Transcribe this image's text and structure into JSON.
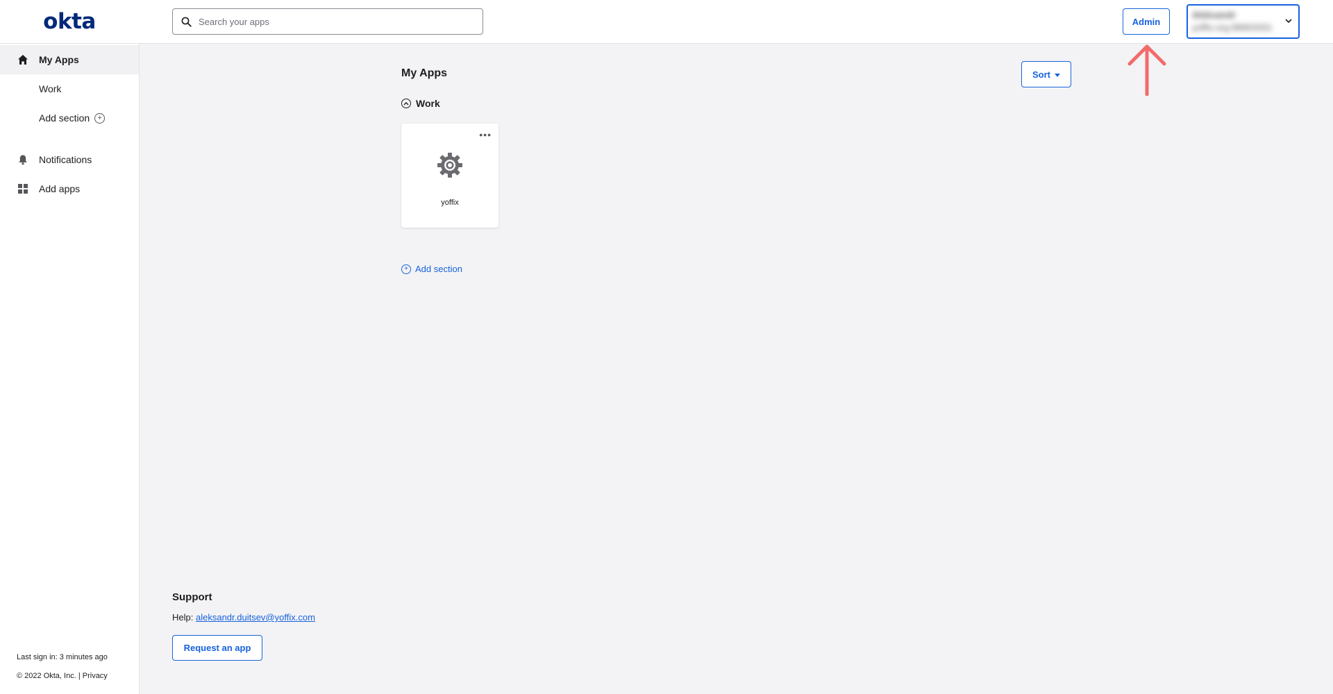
{
  "brand": {
    "logo_text": "okta",
    "logo_color": "#00297a",
    "accent": "#1662dd"
  },
  "sidebar": {
    "items": [
      {
        "label": "My Apps",
        "icon": "home-icon",
        "active": true
      },
      {
        "label": "Work"
      },
      {
        "label": "Add section",
        "icon": "plus-circle-icon"
      },
      {
        "label": "Notifications",
        "icon": "bell-icon"
      },
      {
        "label": "Add apps",
        "icon": "grid-icon"
      }
    ],
    "footer": {
      "last_sign_in": "Last sign in: 3 minutes ago",
      "copyright": "© 2022 Okta, Inc.",
      "separator": "|",
      "privacy": "Privacy"
    }
  },
  "topbar": {
    "search": {
      "placeholder": "Search your apps",
      "value": ""
    },
    "admin_label": "Admin",
    "user": {
      "name": "Aleksandr",
      "org": "yoffix-org-88903331"
    }
  },
  "main": {
    "title": "My Apps",
    "sort_label": "Sort",
    "section": {
      "label": "Work",
      "apps": [
        {
          "name": "yoffix",
          "icon": "gear-icon"
        }
      ]
    },
    "add_section_label": "Add section"
  },
  "support": {
    "title": "Support",
    "help_prefix": "Help:",
    "help_email": "aleksandr.duitsev@yoffix.com",
    "request_label": "Request an app"
  },
  "annotation": {
    "arrow_color": "#f26b6b",
    "icon": "up-arrow-icon"
  }
}
